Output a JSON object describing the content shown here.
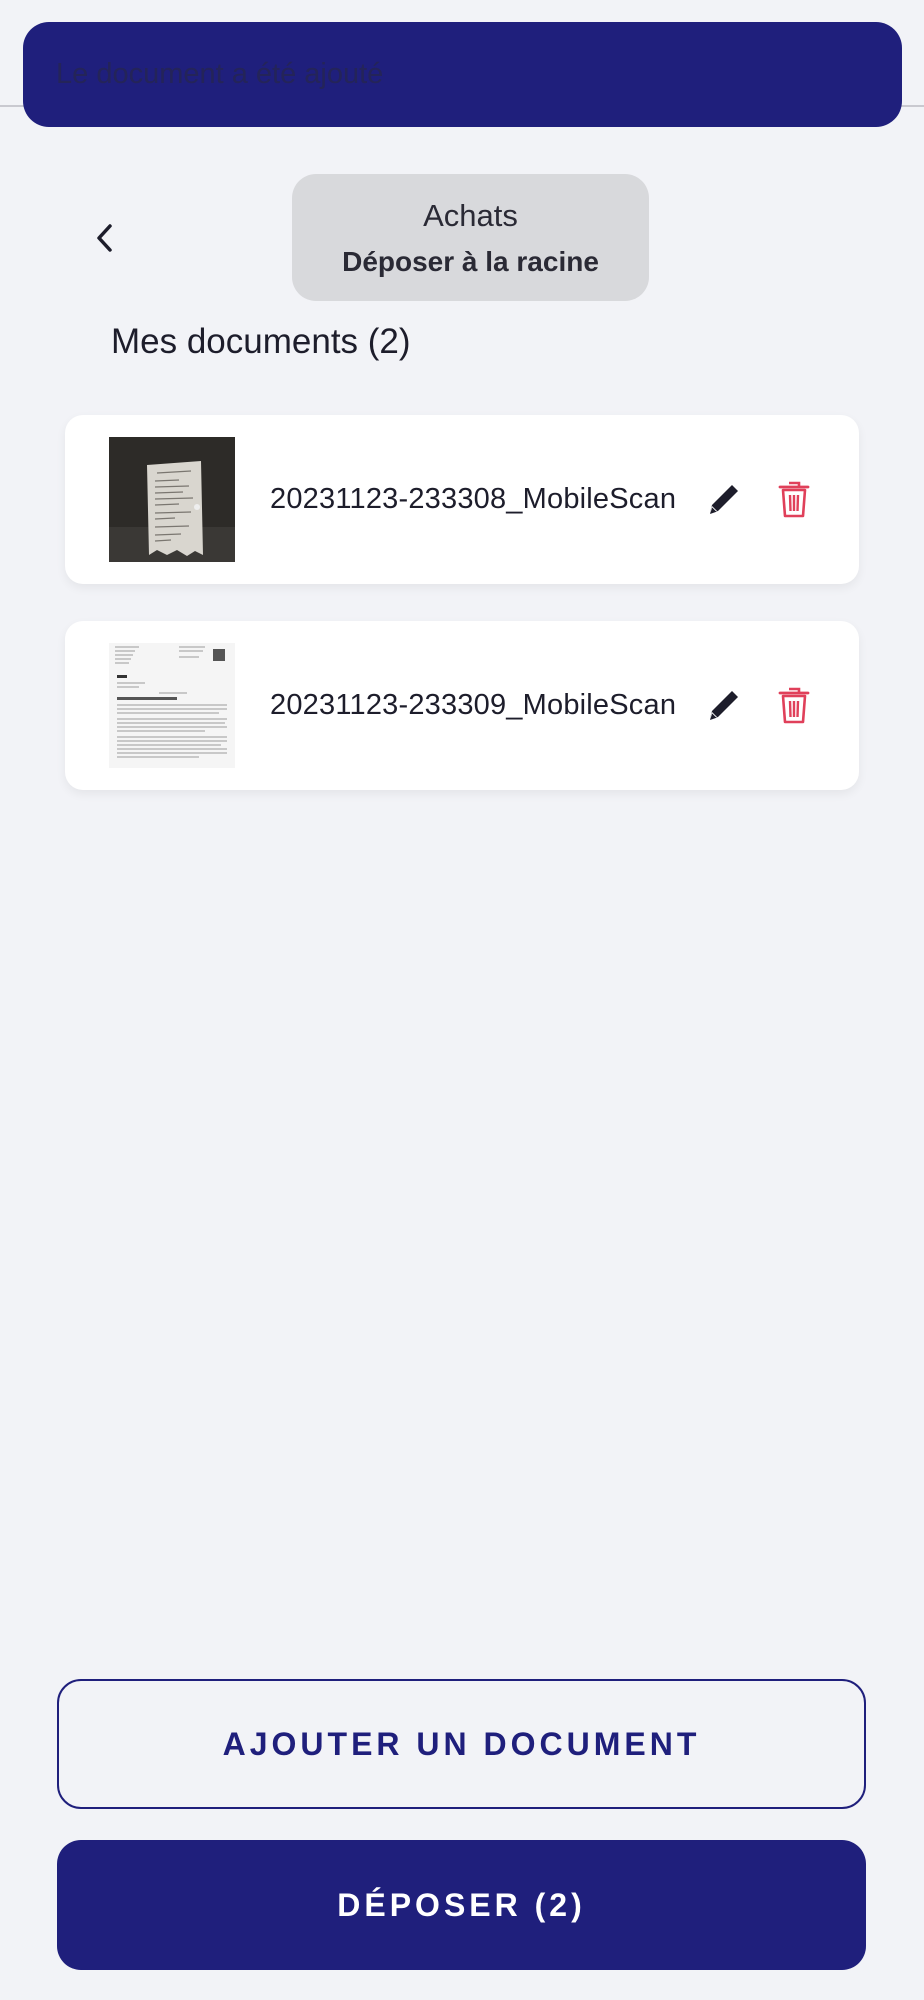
{
  "toast": {
    "message": "Le document a été ajouté"
  },
  "folder": {
    "name": "Achats",
    "action": "Déposer à la racine"
  },
  "documents": {
    "title": "Mes documents (2)",
    "items": [
      {
        "name": "20231123-233308_MobileScan",
        "thumbnail": "receipt-photo"
      },
      {
        "name": "20231123-233309_MobileScan",
        "thumbnail": "letter-scan"
      }
    ]
  },
  "actions": {
    "add_label": "AJOUTER UN DOCUMENT",
    "submit_label": "DÉPOSER (2)"
  },
  "colors": {
    "primary": "#1f1f7c",
    "danger": "#e0405a",
    "background": "#f2f3f7"
  }
}
